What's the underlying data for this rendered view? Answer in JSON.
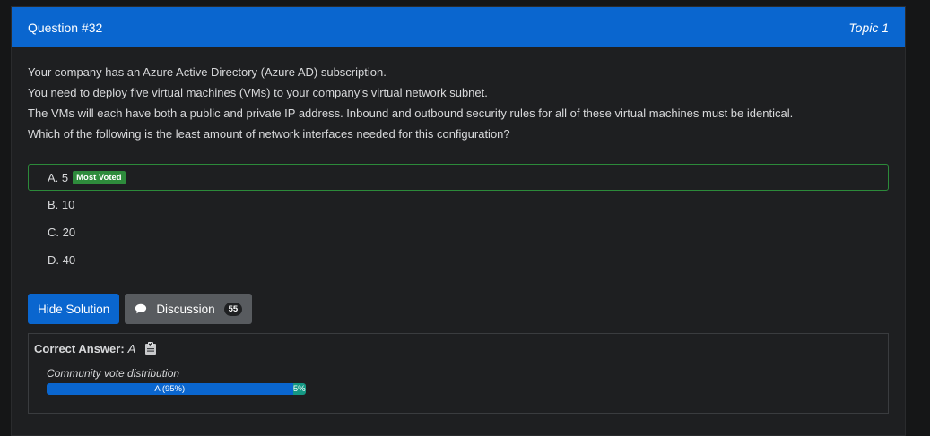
{
  "header": {
    "question_title": "Question #32",
    "topic": "Topic 1"
  },
  "question": {
    "lines": [
      "Your company has an Azure Active Directory (Azure AD) subscription.",
      "You need to deploy five virtual machines (VMs) to your company's virtual network subnet.",
      "The VMs will each have both a public and private IP address. Inbound and outbound security rules for all of these virtual machines must be identical.",
      "Which of the following is the least amount of network interfaces needed for this configuration?"
    ]
  },
  "choices": [
    {
      "label": "A. 5",
      "badge": "Most Voted"
    },
    {
      "label": "B. 10"
    },
    {
      "label": "C. 20"
    },
    {
      "label": "D. 40"
    }
  ],
  "buttons": {
    "hide_solution": "Hide Solution",
    "discussion": "Discussion",
    "discussion_count": "55"
  },
  "answer": {
    "correct_label": "Correct Answer:",
    "correct_value": "A",
    "distribution_label": "Community vote distribution",
    "votes": [
      {
        "text": "A (95%)",
        "percent": 95,
        "color": "#0a66cf"
      },
      {
        "text": "5%",
        "percent": 5,
        "color": "#159884"
      }
    ]
  },
  "icons": {
    "discussion": "speech-bubble-icon",
    "answer": "clipboard-check-icon"
  },
  "colors": {
    "header_bg": "#0a66cf",
    "most_voted_badge": "#2e8b3c",
    "voted_border": "#2c8a3a",
    "discussion_button": "#585b5f"
  }
}
